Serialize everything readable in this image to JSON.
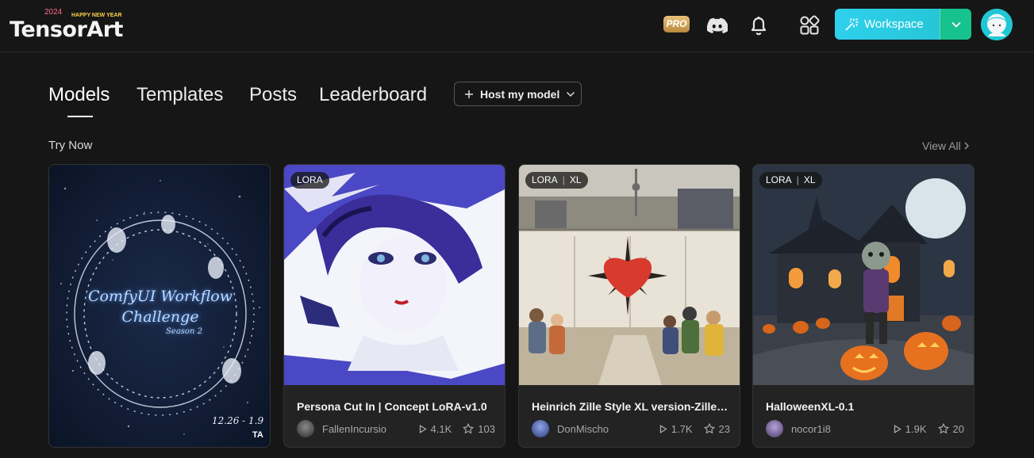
{
  "brand": {
    "logo_text": "TensorArt",
    "logo_deco": "2024",
    "logo_deco2": "HAPPY NEW YEAR"
  },
  "header": {
    "pro_label": "PRO",
    "workspace_label": "Workspace"
  },
  "tabs": [
    {
      "label": "Models",
      "active": true
    },
    {
      "label": "Templates"
    },
    {
      "label": "Posts"
    },
    {
      "label": "Leaderboard"
    }
  ],
  "host_button": "Host my model",
  "section": {
    "title": "Try Now",
    "view_all": "View All"
  },
  "cards": [
    {
      "poster_line1": "ComfyUI Workflow",
      "poster_line2": "Challenge",
      "poster_line3": "Season 2",
      "poster_date": "12.26 - 1.9",
      "poster_mark": "TA"
    },
    {
      "badge": [
        "LORA"
      ],
      "title": "Persona Cut In | Concept LoRA-v1.0",
      "author": "FallenIncursio",
      "runs": "4.1K",
      "stars": "103"
    },
    {
      "badge": [
        "LORA",
        "XL"
      ],
      "title": "Heinrich Zille Style XL version-Zille Style XL",
      "author": "DonMischo",
      "runs": "1.7K",
      "stars": "23"
    },
    {
      "badge": [
        "LORA",
        "XL"
      ],
      "title": "HalloweenXL-0.1",
      "author": "nocor1i8",
      "runs": "1.9K",
      "stars": "20"
    }
  ],
  "colors": {
    "accent": "#2fd0ec",
    "accent2": "#16c28e",
    "background": "#161616",
    "card": "#232323"
  }
}
